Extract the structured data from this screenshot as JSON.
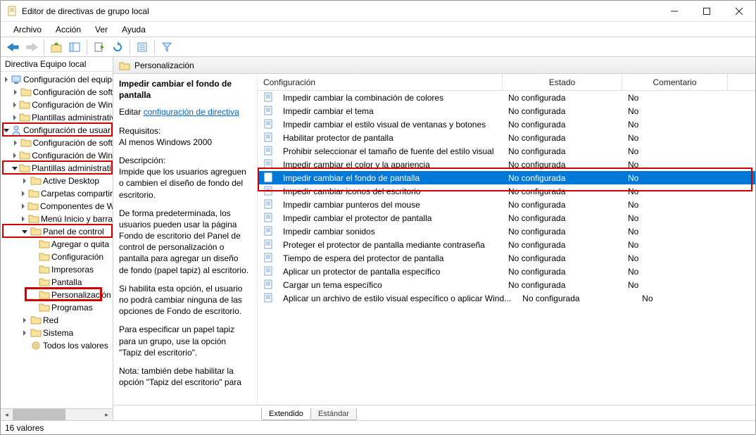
{
  "window": {
    "title": "Editor de directivas de grupo local"
  },
  "menu": {
    "archivo": "Archivo",
    "accion": "Acción",
    "ver": "Ver",
    "ayuda": "Ayuda"
  },
  "tree": {
    "header": "Directiva Equipo local",
    "nodes": [
      {
        "indent": 0,
        "chev": "right",
        "icon": "computer",
        "label": "Configuración del equipo"
      },
      {
        "indent": 1,
        "chev": "right",
        "icon": "folder",
        "label": "Configuración de soft"
      },
      {
        "indent": 1,
        "chev": "right",
        "icon": "folder",
        "label": "Configuración de Win"
      },
      {
        "indent": 1,
        "chev": "right",
        "icon": "folder",
        "label": "Plantillas administrativ"
      },
      {
        "indent": 0,
        "chev": "down",
        "icon": "user",
        "label": "Configuración de usuario",
        "hl": true
      },
      {
        "indent": 1,
        "chev": "right",
        "icon": "folder",
        "label": "Configuración de soft"
      },
      {
        "indent": 1,
        "chev": "right",
        "icon": "folder",
        "label": "Configuración de Win"
      },
      {
        "indent": 1,
        "chev": "down",
        "icon": "folder",
        "label": "Plantillas administrativ",
        "hl": true
      },
      {
        "indent": 2,
        "chev": "right",
        "icon": "folder",
        "label": "Active Desktop"
      },
      {
        "indent": 2,
        "chev": "right",
        "icon": "folder",
        "label": "Carpetas compartir"
      },
      {
        "indent": 2,
        "chev": "right",
        "icon": "folder",
        "label": "Componentes de W"
      },
      {
        "indent": 2,
        "chev": "right",
        "icon": "folder",
        "label": "Menú Inicio y barra"
      },
      {
        "indent": 2,
        "chev": "down",
        "icon": "folder",
        "label": "Panel de control",
        "hl": true
      },
      {
        "indent": 3,
        "chev": "none",
        "icon": "folder",
        "label": "Agregar o quita"
      },
      {
        "indent": 3,
        "chev": "none",
        "icon": "folder",
        "label": "Configuración"
      },
      {
        "indent": 3,
        "chev": "none",
        "icon": "folder",
        "label": "Impresoras"
      },
      {
        "indent": 3,
        "chev": "none",
        "icon": "folder",
        "label": "Pantalla"
      },
      {
        "indent": 3,
        "chev": "none",
        "icon": "folder",
        "label": "Personalización",
        "hl": true,
        "hlfill": true
      },
      {
        "indent": 3,
        "chev": "none",
        "icon": "folder",
        "label": "Programas"
      },
      {
        "indent": 2,
        "chev": "right",
        "icon": "folder",
        "label": "Red"
      },
      {
        "indent": 2,
        "chev": "right",
        "icon": "folder",
        "label": "Sistema"
      },
      {
        "indent": 2,
        "chev": "none",
        "icon": "settings",
        "label": "Todos los valores"
      }
    ]
  },
  "content": {
    "header_title": "Personalización",
    "description": {
      "title": "Impedir cambiar el fondo de pantalla",
      "edit_prefix": "Editar ",
      "edit_link": "configuración de directiva",
      "requisitos_label": "Requisitos:",
      "requisitos_value": "Al menos Windows 2000",
      "descripcion_label": "Descripción:",
      "p1": "Impide que los usuarios agreguen o cambien el diseño de fondo del escritorio.",
      "p2": "De forma predeterminada, los usuarios pueden usar la página Fondo de escritorio del Panel de control de personalización o pantalla para agregar un diseño de fondo (papel tapiz) al escritorio.",
      "p3": "Si habilita esta opción, el usuario no podrá cambiar ninguna de las opciones de Fondo de escritorio.",
      "p4": "Para especificar un papel tapiz para un grupo, use la opción \"Tapiz del escritorio\".",
      "p5": "Nota: también debe habilitar la opción \"Tapiz del escritorio\" para"
    },
    "columns": {
      "config": "Configuración",
      "estado": "Estado",
      "comentario": "Comentario"
    },
    "rows": [
      {
        "name": "Impedir cambiar la combinación de colores",
        "estado": "No configurada",
        "com": "No"
      },
      {
        "name": "Impedir cambiar el tema",
        "estado": "No configurada",
        "com": "No"
      },
      {
        "name": "Impedir cambiar el estilo visual de ventanas y botones",
        "estado": "No configurada",
        "com": "No"
      },
      {
        "name": "Habilitar protector de pantalla",
        "estado": "No configurada",
        "com": "No"
      },
      {
        "name": "Prohibir seleccionar el tamaño de fuente del estilo visual",
        "estado": "No configurada",
        "com": "No"
      },
      {
        "name": "Impedir cambiar el color y la apariencia",
        "estado": "No configurada",
        "com": "No"
      },
      {
        "name": "Impedir cambiar el fondo de pantalla",
        "estado": "No configurada",
        "com": "No",
        "selected": true
      },
      {
        "name": "Impedir cambiar iconos del escritorio",
        "estado": "No configurada",
        "com": "No"
      },
      {
        "name": "Impedir cambiar punteros del mouse",
        "estado": "No configurada",
        "com": "No"
      },
      {
        "name": "Impedir cambiar el protector de pantalla",
        "estado": "No configurada",
        "com": "No"
      },
      {
        "name": "Impedir cambiar sonidos",
        "estado": "No configurada",
        "com": "No"
      },
      {
        "name": "Proteger el protector de pantalla mediante contraseña",
        "estado": "No configurada",
        "com": "No"
      },
      {
        "name": "Tiempo de espera del protector de pantalla",
        "estado": "No configurada",
        "com": "No"
      },
      {
        "name": "Aplicar un protector de pantalla específico",
        "estado": "No configurada",
        "com": "No"
      },
      {
        "name": "Cargar un tema específico",
        "estado": "No configurada",
        "com": "No"
      },
      {
        "name": "Aplicar un archivo de estilo visual específico o aplicar Wind...",
        "estado": "No configurada",
        "com": "No"
      }
    ],
    "tabs": {
      "extendido": "Extendido",
      "estandar": "Estándar"
    }
  },
  "statusbar": {
    "count": "16 valores"
  }
}
